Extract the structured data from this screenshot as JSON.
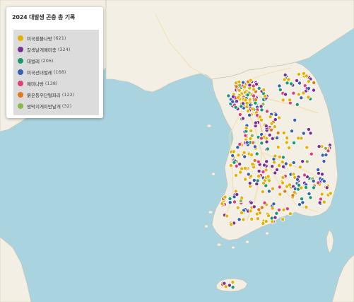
{
  "legend": {
    "title": "2024 대발생 곤충 총 기록",
    "items": [
      {
        "name": "미국흰불나방",
        "count": "(621)",
        "color": "#e6b000"
      },
      {
        "name": "갈색날개매미충",
        "count": "(324)",
        "color": "#7b2e96"
      },
      {
        "name": "대벌레",
        "count": "(206)",
        "color": "#159a72"
      },
      {
        "name": "미국선녀벌레",
        "count": "(168)",
        "color": "#3462b0"
      },
      {
        "name": "매미나방",
        "count": "(138)",
        "color": "#e33c7a"
      },
      {
        "name": "붉은등우단털파리",
        "count": "(122)",
        "color": "#e3771a"
      },
      {
        "name": "썽막지게미반날개",
        "count": "(32)",
        "color": "#86b84a"
      }
    ]
  },
  "map_colors": {
    "sea": "#a9d3df",
    "land": "#f3efe4",
    "road_major": "#f7c88a",
    "road_minor": "#f3deb0"
  }
}
